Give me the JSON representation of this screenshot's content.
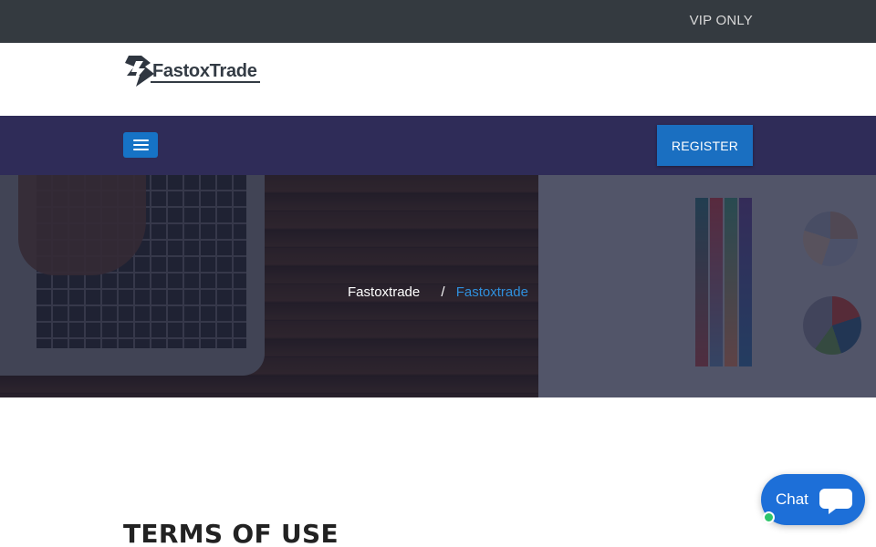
{
  "topbar": {
    "vip_label": "VIP ONLY"
  },
  "brand": {
    "logo_text": "FastoxTrade"
  },
  "nav": {
    "register_label": "REGISTER"
  },
  "hero": {
    "breadcrumb_home": "Fastoxtrade",
    "breadcrumb_separator": "/",
    "breadcrumb_current": "Fastoxtrade"
  },
  "main": {
    "title": "TERMS OF USE"
  },
  "chat": {
    "label": "Chat"
  },
  "icons": {
    "menu": "hamburger-icon",
    "chat": "chat-bubble-icon",
    "logo": "lightning-logo-icon",
    "status": "online-status-dot"
  },
  "colors": {
    "topbar": "#343a40",
    "navbar": "#2f2c58",
    "accent": "#1a6fc1",
    "breadcrumb_current": "#2f8fdc",
    "chat": "#1d6fd8",
    "online": "#2ec56a"
  }
}
